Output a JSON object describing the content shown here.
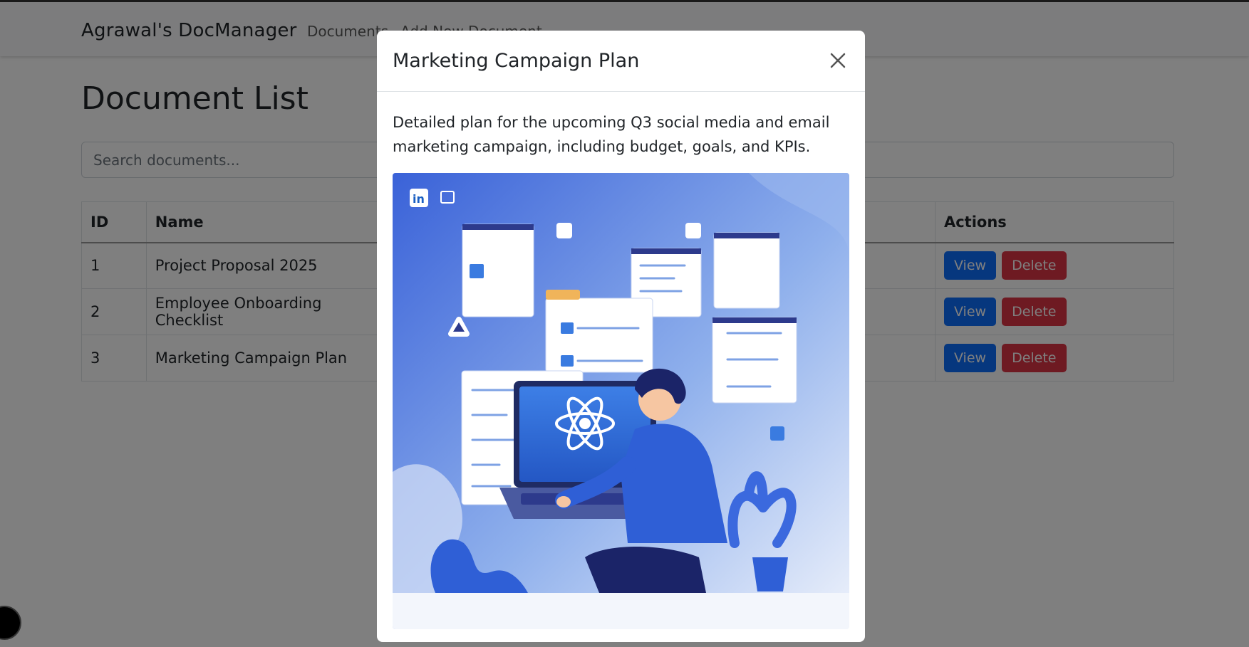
{
  "app": {
    "brand": "Agrawal's DocManager",
    "nav": [
      "Documents",
      "Add New Document"
    ]
  },
  "page": {
    "title": "Document List",
    "search_placeholder": "Search documents..."
  },
  "table": {
    "headers": [
      "ID",
      "Name",
      "",
      "Actions"
    ],
    "rows": [
      {
        "id": "1",
        "name": "Project Proposal 2025"
      },
      {
        "id": "2",
        "name": "Employee Onboarding Checklist"
      },
      {
        "id": "3",
        "name": "Marketing Campaign Plan"
      }
    ],
    "view_label": "View",
    "delete_label": "Delete"
  },
  "modal": {
    "title": "Marketing Campaign Plan",
    "description": "Detailed plan for the upcoming Q3 social media and email marketing campaign, including budget, goals, and KPIs.",
    "image_icons": [
      "linkedin-icon",
      "react-logo-icon"
    ]
  },
  "colors": {
    "primary": "#0d6efd",
    "danger": "#dc3545",
    "illustration_blue": "#3a62d8"
  }
}
